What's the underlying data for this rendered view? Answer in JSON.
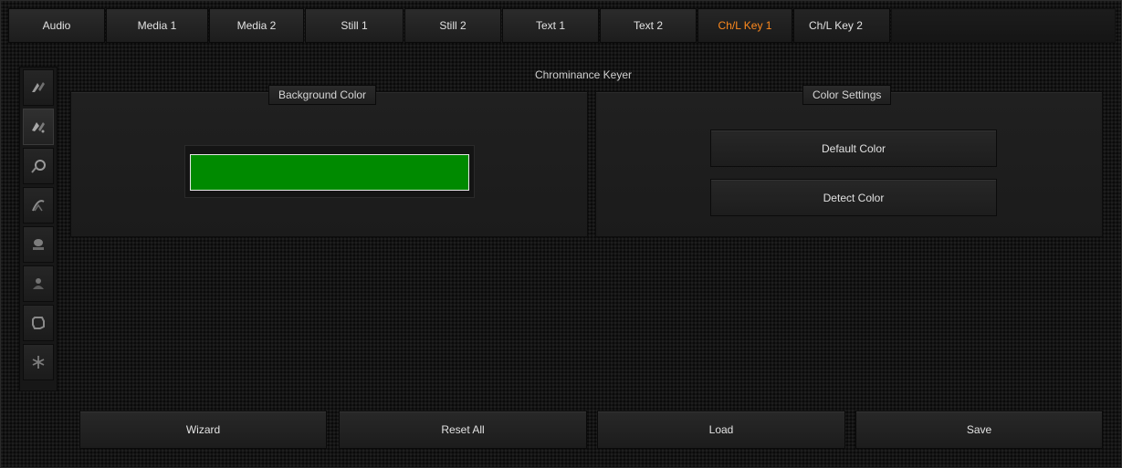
{
  "tabs": [
    {
      "label": "Audio",
      "active": false
    },
    {
      "label": "Media 1",
      "active": false
    },
    {
      "label": "Media 2",
      "active": false
    },
    {
      "label": "Still 1",
      "active": false
    },
    {
      "label": "Still 2",
      "active": false
    },
    {
      "label": "Text 1",
      "active": false
    },
    {
      "label": "Text 2",
      "active": false
    },
    {
      "label": "Ch/L Key 1",
      "active": true
    },
    {
      "label": "Ch/L Key 2",
      "active": false
    }
  ],
  "colors": {
    "accent_active_tab": "#ff8a1e",
    "key_color_swatch": "#008a00"
  },
  "tools": [
    {
      "icon": "chroma-key-tool-icon",
      "selected": false
    },
    {
      "icon": "chroma-key-alt-tool-icon",
      "selected": true
    },
    {
      "icon": "color-picker-tool-icon",
      "selected": false
    },
    {
      "icon": "spill-tool-icon",
      "selected": false
    },
    {
      "icon": "mask-tool-icon",
      "selected": false
    },
    {
      "icon": "person-tool-icon",
      "selected": false
    },
    {
      "icon": "crop-tool-icon",
      "selected": false
    },
    {
      "icon": "effects-tool-icon",
      "selected": false
    }
  ],
  "main": {
    "title": "Chrominance Keyer",
    "background_color_panel": {
      "label": "Background Color"
    },
    "color_settings_panel": {
      "label": "Color Settings",
      "default_color_label": "Default Color",
      "detect_color_label": "Detect Color"
    }
  },
  "footer": {
    "wizard_label": "Wizard",
    "reset_all_label": "Reset All",
    "load_label": "Load",
    "save_label": "Save"
  }
}
